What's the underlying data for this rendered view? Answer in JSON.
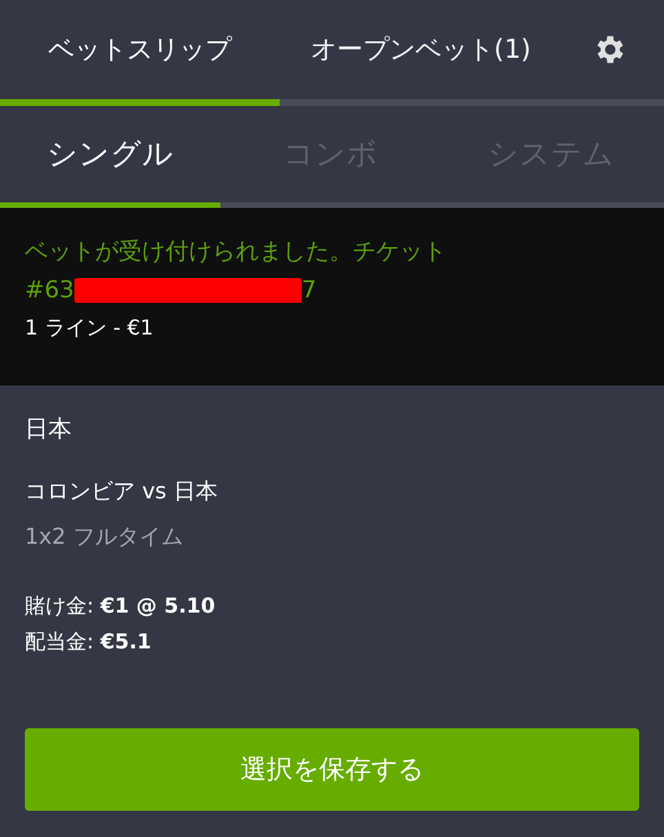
{
  "main_tabs": [
    {
      "label": "ベットスリップ",
      "selected": true
    },
    {
      "label": "オープンベット(1)",
      "selected": false
    }
  ],
  "bet_types": [
    {
      "label": "シングル",
      "selected": true
    },
    {
      "label": "コンボ",
      "selected": false
    },
    {
      "label": "システム",
      "selected": false
    }
  ],
  "confirmation": {
    "message": "ベットが受け付けられました。チケット",
    "ticket_start": "#63",
    "ticket_end": "7",
    "redacted": true,
    "summary": "1 ライン - €1"
  },
  "selection": {
    "pick": "日本",
    "match": "コロンビア  vs  日本",
    "market": "1x2 フルタイム",
    "stake": "賭け金: **€1  @ 5.10**",
    "payout": "配当金: **€5.1**"
  },
  "save_button": "選択を保存する"
}
